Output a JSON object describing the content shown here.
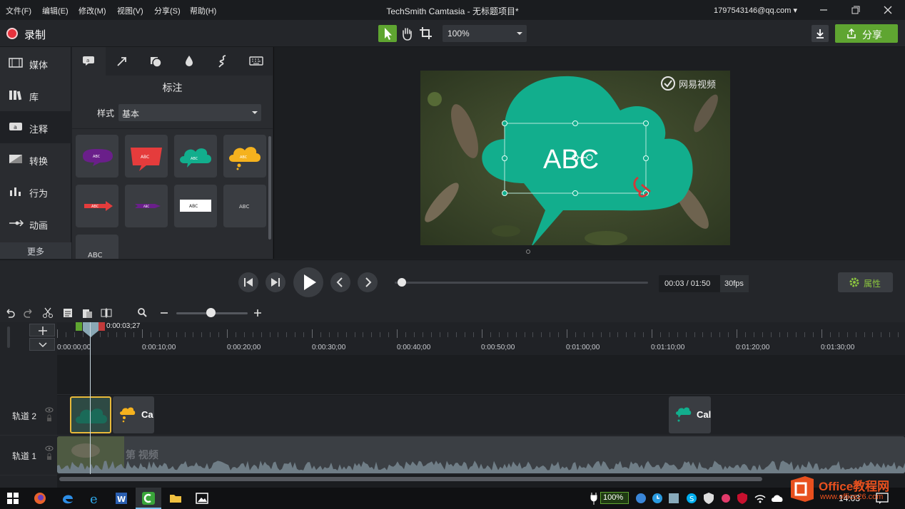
{
  "menu": {
    "items": [
      "文件(F)",
      "编辑(E)",
      "修改(M)",
      "视图(V)",
      "分享(S)",
      "帮助(H)"
    ],
    "title": "TechSmith Camtasia - 无标题项目*",
    "account": "1797543146@qq.com ▾"
  },
  "toolbar": {
    "record_label": "录制",
    "zoom_value": "100%",
    "share_label": "分享"
  },
  "sidebar": {
    "items": [
      {
        "label": "媒体",
        "icon": "film-icon"
      },
      {
        "label": "库",
        "icon": "library-icon"
      },
      {
        "label": "注释",
        "icon": "annotation-icon"
      },
      {
        "label": "转换",
        "icon": "transition-icon"
      },
      {
        "label": "行为",
        "icon": "behavior-icon"
      },
      {
        "label": "动画",
        "icon": "animation-icon"
      }
    ],
    "more_label": "更多"
  },
  "panel": {
    "tabs": [
      "callout-tab-icon",
      "arrow-tab-icon",
      "shape-tab-icon",
      "blur-tab-icon",
      "sketch-tab-icon",
      "keystroke-tab-icon"
    ],
    "title": "标注",
    "style_label": "样式",
    "style_value": "基本",
    "callout_text": "ABC"
  },
  "preview": {
    "callout_text": "ABC",
    "watermark_text": "网易视频",
    "callout_color": "#12ae8d"
  },
  "playback": {
    "time": "00:03 / 01:50",
    "fps": "30fps",
    "properties_label": "属性",
    "progress": 0.027
  },
  "timeline": {
    "playhead_time": "0:00:03;27",
    "ruler_labels": [
      "0:00:00;00",
      "0:00:10;00",
      "0:00:20;00",
      "0:00:30;00",
      "0:00:40;00",
      "0:00:50;00",
      "0:01:00;00",
      "0:01:10;00",
      "0:01:20;00",
      "0:01:30;00"
    ],
    "tracks": [
      {
        "name": "轨道 2",
        "clips": [
          {
            "label": "",
            "kind": "teal-cloud"
          },
          {
            "label": "Ca",
            "kind": "yellow-cloud"
          },
          {
            "label": "Cal",
            "kind": "teal-cloud-small"
          }
        ]
      },
      {
        "name": "轨道 1",
        "clips": [
          {
            "label": "第 视频",
            "kind": "video"
          }
        ]
      }
    ]
  },
  "taskbar": {
    "battery": "100%",
    "clock": "14:03"
  },
  "watermark": {
    "title": "Office教程网",
    "url": "www.office26.com"
  },
  "colors": {
    "accent_green": "#5fa531",
    "record_red": "#e8323d",
    "callout_teal": "#12ae8d"
  }
}
